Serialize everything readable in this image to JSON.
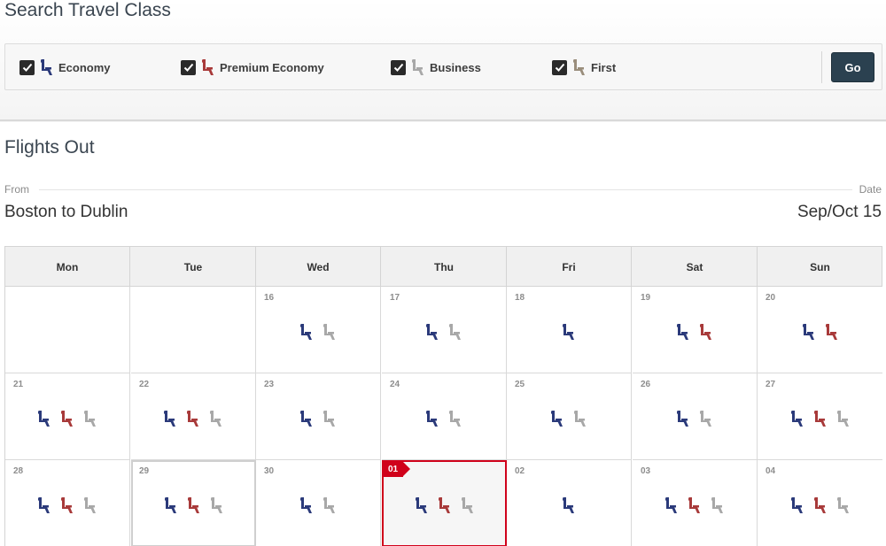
{
  "search": {
    "title": "Search Travel Class",
    "classes": [
      {
        "label": "Economy",
        "checked": true,
        "icon": "seat-economy-icon",
        "color": "#2b3a7a"
      },
      {
        "label": "Premium Economy",
        "checked": true,
        "icon": "seat-premium-icon",
        "color": "#a83a3a"
      },
      {
        "label": "Business",
        "checked": true,
        "icon": "seat-business-icon",
        "color": "#a8a8a8"
      },
      {
        "label": "First",
        "checked": true,
        "icon": "seat-first-icon",
        "color": "#9a8e7c"
      }
    ],
    "go_label": "Go"
  },
  "flights": {
    "title": "Flights Out",
    "from_label": "From",
    "date_label": "Date",
    "route": "Boston to Dublin",
    "date_value": "Sep/Oct 15"
  },
  "calendar": {
    "weekdays": [
      "Mon",
      "Tue",
      "Wed",
      "Thu",
      "Fri",
      "Sat",
      "Sun"
    ],
    "weeks": [
      [
        {
          "day": "",
          "seats": []
        },
        {
          "day": "",
          "seats": []
        },
        {
          "day": "16",
          "seats": [
            "economy",
            "business"
          ]
        },
        {
          "day": "17",
          "seats": [
            "economy",
            "business"
          ]
        },
        {
          "day": "18",
          "seats": [
            "economy"
          ]
        },
        {
          "day": "19",
          "seats": [
            "economy",
            "premium"
          ]
        },
        {
          "day": "20",
          "seats": [
            "economy",
            "premium"
          ]
        }
      ],
      [
        {
          "day": "21",
          "seats": [
            "economy",
            "premium",
            "business"
          ]
        },
        {
          "day": "22",
          "seats": [
            "economy",
            "premium",
            "business"
          ]
        },
        {
          "day": "23",
          "seats": [
            "economy",
            "business"
          ]
        },
        {
          "day": "24",
          "seats": [
            "economy",
            "business"
          ]
        },
        {
          "day": "25",
          "seats": [
            "economy",
            "business"
          ]
        },
        {
          "day": "26",
          "seats": [
            "economy",
            "business"
          ]
        },
        {
          "day": "27",
          "seats": [
            "economy",
            "premium",
            "business"
          ]
        }
      ],
      [
        {
          "day": "28",
          "seats": [
            "economy",
            "premium",
            "business"
          ]
        },
        {
          "day": "29",
          "seats": [
            "economy",
            "premium",
            "business"
          ],
          "state": "today"
        },
        {
          "day": "30",
          "seats": [
            "economy",
            "business"
          ]
        },
        {
          "day": "01",
          "seats": [
            "economy",
            "premium",
            "business"
          ],
          "state": "selected"
        },
        {
          "day": "02",
          "seats": [
            "economy"
          ]
        },
        {
          "day": "03",
          "seats": [
            "economy",
            "premium",
            "business"
          ]
        },
        {
          "day": "04",
          "seats": [
            "economy",
            "premium",
            "business"
          ]
        }
      ]
    ],
    "seat_colors": {
      "economy": "#2b3a7a",
      "premium": "#a83a3a",
      "business": "#a8a8a8",
      "first": "#9a8e7c"
    },
    "selected_color": "#d0021b"
  }
}
